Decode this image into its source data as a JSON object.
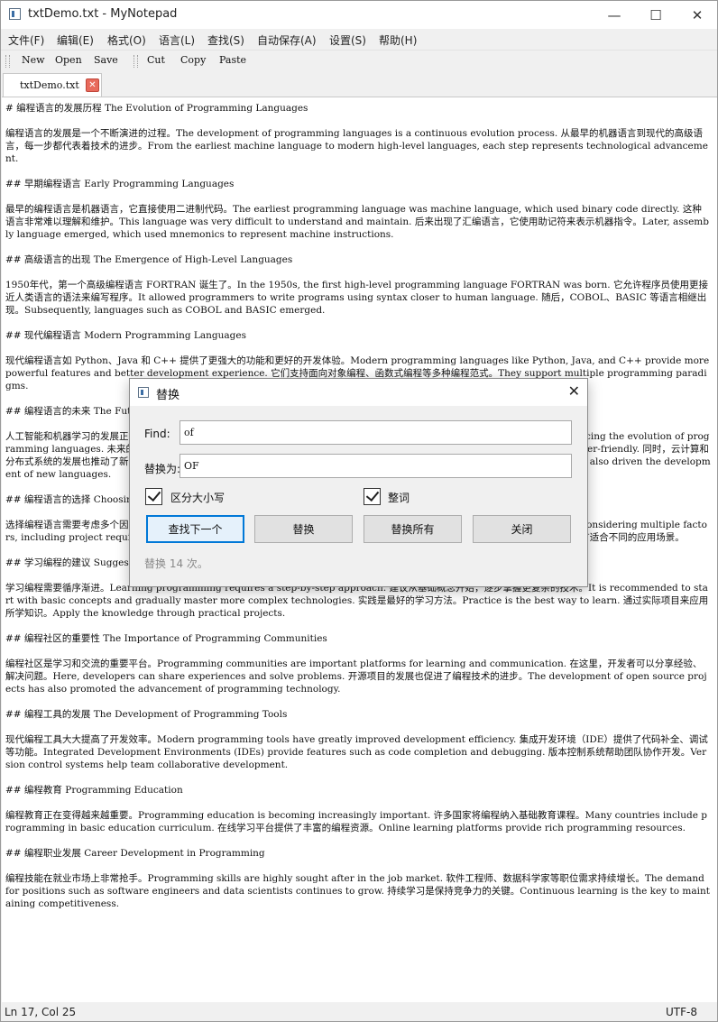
{
  "window": {
    "title": "txtDemo.txt - MyNotepad",
    "minimize_glyph": "—",
    "maximize_glyph": "☐",
    "close_glyph": "✕"
  },
  "menu": [
    "文件(F)",
    "编辑(E)",
    "格式(O)",
    "语言(L)",
    "查找(S)",
    "自动保存(A)",
    "设置(S)",
    "帮助(H)"
  ],
  "toolbar": {
    "new": "New",
    "open": "Open",
    "save": "Save",
    "cut": "Cut",
    "copy": "Copy",
    "paste": "Paste"
  },
  "tab": {
    "label": "txtDemo.txt",
    "close_glyph": "✕"
  },
  "editor": {
    "text": "# 编程语言的发展历程 The Evolution of Programming Languages\n\n编程语言的发展是一个不断演进的过程。The development of programming languages is a continuous evolution process. 从最早的机器语言到现代的高级语言，每一步都代表着技术的进步。From the earliest machine language to modern high-level languages, each step represents technological advancement.\n\n## 早期编程语言 Early Programming Languages\n\n最早的编程语言是机器语言，它直接使用二进制代码。The earliest programming language was machine language, which used binary code directly. 这种语言非常难以理解和维护。This language was very difficult to understand and maintain. 后来出现了汇编语言，它使用助记符来表示机器指令。Later, assembly language emerged, which used mnemonics to represent machine instructions.\n\n## 高级语言的出现 The Emergence of High-Level Languages\n\n1950年代，第一个高级编程语言 FORTRAN 诞生了。In the 1950s, the first high-level programming language FORTRAN was born. 它允许程序员使用更接近人类语言的语法来编写程序。It allowed programmers to write programs using syntax closer to human language. 随后，COBOL、BASIC 等语言相继出现。Subsequently, languages such as COBOL and BASIC emerged.\n\n## 现代编程语言 Modern Programming Languages\n\n现代编程语言如 Python、Java 和 C++ 提供了更强大的功能和更好的开发体验。Modern programming languages like Python, Java, and C++ provide more powerful features and better development experience. 它们支持面向对象编程、函数式编程等多种编程范式。They support multiple programming paradigms.\n\n## 编程语言的未来 The Future of Programming Languages\n\n人工智能和机器学习的发展正在影响编程语言的演进。The development of artificial intelligence and machine learning is influencing the evolution of programming languages. 未来的编程语言将更加智能和易用。Future programming languages will become more intelligent and user-friendly. 同时，云计算和分布式系统的发展也推动了新语言的诞生。At the same time, the development of distributed systems and cloud computing has also driven the development of new languages.\n\n## 编程语言的选择 Choosing a Programming Language\n\n选择编程语言需要考虑多个因素，包括项目需求、开发团队的技术背景、性能要求等。Choosing a programming language requires considering multiple factors, including project requirements, development team's technical background, and performance requirements. 不同的语言适合不同的应用场景。\n\n## 学习编程的建议 Suggestions for Learning Programming\n\n学习编程需要循序渐进。Learning programming requires a step-by-step approach. 建议从基础概念开始，逐步掌握更复杂的技术。It is recommended to start with basic concepts and gradually master more complex technologies. 实践是最好的学习方法。Practice is the best way to learn. 通过实际项目来应用所学知识。Apply the knowledge through practical projects.\n\n## 编程社区的重要性 The Importance of Programming Communities\n\n编程社区是学习和交流的重要平台。Programming communities are important platforms for learning and communication. 在这里，开发者可以分享经验、解决问题。Here, developers can share experiences and solve problems. 开源项目的发展也促进了编程技术的进步。The development of open source projects has also promoted the advancement of programming technology.\n\n## 编程工具的发展 The Development of Programming Tools\n\n现代编程工具大大提高了开发效率。Modern programming tools have greatly improved development efficiency. 集成开发环境（IDE）提供了代码补全、调试等功能。Integrated Development Environments (IDEs) provide features such as code completion and debugging. 版本控制系统帮助团队协作开发。Version control systems help team collaborative development.\n\n## 编程教育 Programming Education\n\n编程教育正在变得越来越重要。Programming education is becoming increasingly important. 许多国家将编程纳入基础教育课程。Many countries include programming in basic education curriculum. 在线学习平台提供了丰富的编程资源。Online learning platforms provide rich programming resources.\n\n## 编程职业发展 Career Development in Programming\n\n编程技能在就业市场上非常抢手。Programming skills are highly sought after in the job market. 软件工程师、数据科学家等职位需求持续增长。The demand for positions such as software engineers and data scientists continues to grow. 持续学习是保持竞争力的关键。Continuous learning is the key to maintaining competitiveness."
  },
  "status": {
    "position": "Ln 17, Col 25",
    "encoding": "UTF-8"
  },
  "dialog": {
    "title": "替换",
    "close_glyph": "✕",
    "find_label": "Find:",
    "find_value": "of",
    "replace_label": "替换为:",
    "replace_value": "OF",
    "case_sensitive_label": "区分大小写",
    "case_sensitive_checked": true,
    "whole_word_label": "整词",
    "whole_word_checked": true,
    "btn_find_next": "查找下一个",
    "btn_replace": "替换",
    "btn_replace_all": "替换所有",
    "btn_close": "关闭",
    "status_text": "替换 14 次。"
  }
}
